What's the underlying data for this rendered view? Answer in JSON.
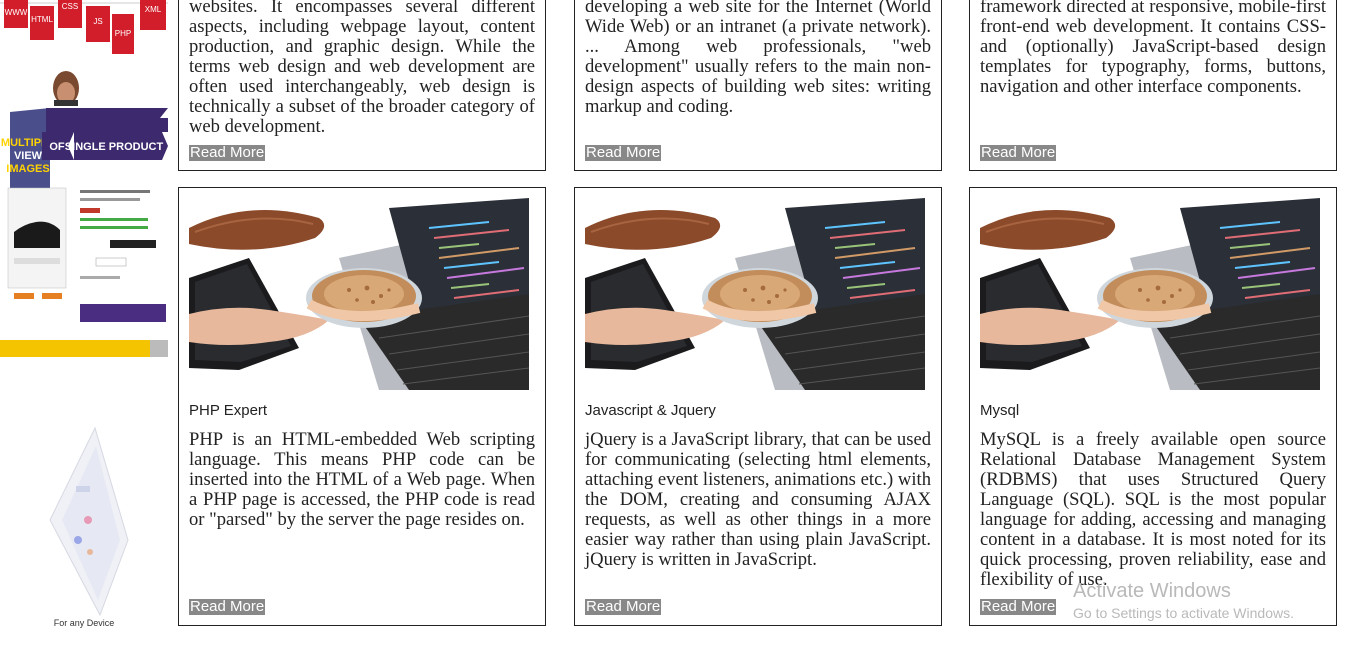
{
  "sidebar": {
    "banner_tags": [
      "WWW",
      "HTML",
      "CSS",
      "JS",
      "PHP",
      "XML"
    ],
    "promo_multiple": "MULTIPLE",
    "promo_view": "VIEW",
    "promo_images": "IMAGES",
    "promo_of": "OF",
    "promo_single_product": "SINGLE PRODUCT",
    "device_caption": "For any Device"
  },
  "top_cards": [
    {
      "text": "websites. It encompasses several different aspects, including webpage layout, content production, and graphic design. While the terms web design and web development are often used interchangeably, web design is technically a subset of the broader category of web development.",
      "read_more": "Read More"
    },
    {
      "text": "developing a web site for the Internet (World Wide Web) or an intranet (a private network). ... Among web professionals, \"web development\" usually refers to the main non-design aspects of building web sites: writing markup and coding.",
      "read_more": "Read More"
    },
    {
      "text": "framework directed at responsive, mobile-first front-end web development. It contains CSS- and (optionally) JavaScript-based design templates for typography, forms, buttons, navigation and other interface components.",
      "read_more": "Read More"
    }
  ],
  "cards": [
    {
      "title": "PHP Expert",
      "text": "PHP is an HTML-embedded Web scripting language. This means PHP code can be inserted into the HTML of a Web page. When a PHP page is accessed, the PHP code is read or \"parsed\" by the server the page resides on.",
      "read_more": "Read More"
    },
    {
      "title": "Javascript & Jquery",
      "text": "jQuery is a JavaScript library, that can be used for communicating (selecting html elements, attaching event listeners, animations etc.) with the DOM, creating and consuming AJAX requests, as well as other things in a more easier way rather than using plain JavaScript. jQuery is written in JavaScript.",
      "read_more": "Read More"
    },
    {
      "title": "Mysql",
      "text": "MySQL is a freely available open source Relational Database Management System (RDBMS) that uses Structured Query Language (SQL). SQL is the most popular language for adding, accessing and managing content in a database. It is most noted for its quick processing, proven reliability, ease and flexibility of use.",
      "read_more": "Read More"
    }
  ],
  "watermark": {
    "line1": "Activate Windows",
    "line2": "Go to Settings to activate Windows."
  },
  "colors": {
    "read_more_bg": "#888888",
    "border": "#222222",
    "promo_purple": "#3d2a6e",
    "tag_red": "#d11e2a",
    "banner_yellow": "#f5c400"
  }
}
